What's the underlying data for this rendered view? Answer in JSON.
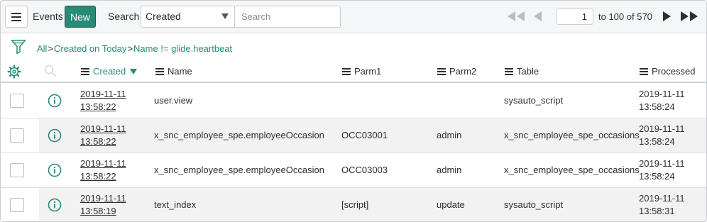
{
  "header": {
    "title": "Events",
    "new_label": "New",
    "search_label": "Search",
    "search_field": "Created",
    "search_placeholder": "Search",
    "page_value": "1",
    "page_range": "to 100 of 570"
  },
  "breadcrumb": {
    "items": [
      "All",
      "Created on Today",
      "Name != glide.heartbeat"
    ],
    "separator": ">"
  },
  "columns": {
    "created": "Created",
    "name": "Name",
    "parm1": "Parm1",
    "parm2": "Parm2",
    "table": "Table",
    "processed": "Processed"
  },
  "rows": [
    {
      "created_date": "2019-11-11",
      "created_time": "13:58:22",
      "name": "user.view",
      "parm1": "",
      "parm2": "",
      "table": "sysauto_script",
      "processed_date": "2019-11-11",
      "processed_time": "13:58:24"
    },
    {
      "created_date": "2019-11-11",
      "created_time": "13:58:22",
      "name": "x_snc_employee_spe.employeeOccasion",
      "parm1": "OCC03001",
      "parm2": "admin",
      "table": "x_snc_employee_spe_occasions",
      "processed_date": "2019-11-11",
      "processed_time": "13:58:24"
    },
    {
      "created_date": "2019-11-11",
      "created_time": "13:58:22",
      "name": "x_snc_employee_spe.employeeOccasion",
      "parm1": "OCC03003",
      "parm2": "admin",
      "table": "x_snc_employee_spe_occasions",
      "processed_date": "2019-11-11",
      "processed_time": "13:58:24"
    },
    {
      "created_date": "2019-11-11",
      "created_time": "13:58:19",
      "name": "text_index",
      "parm1": "[script]",
      "parm2": "update",
      "table": "sysauto_script",
      "processed_date": "2019-11-11",
      "processed_time": "13:58:31"
    }
  ],
  "colors": {
    "accent": "#278b76",
    "header_bg": "#f5f6f7",
    "row_alt_bg": "#f2f2f2"
  },
  "icons": {
    "menu": "hamburger-menu-icon",
    "filter": "funnel-filter-icon",
    "gear": "gear-icon",
    "search": "magnifier-icon",
    "info": "info-circle-icon",
    "first": "double-chevron-left-icon",
    "prev": "triangle-left-icon",
    "next": "triangle-right-icon",
    "last": "double-triangle-right-icon"
  }
}
